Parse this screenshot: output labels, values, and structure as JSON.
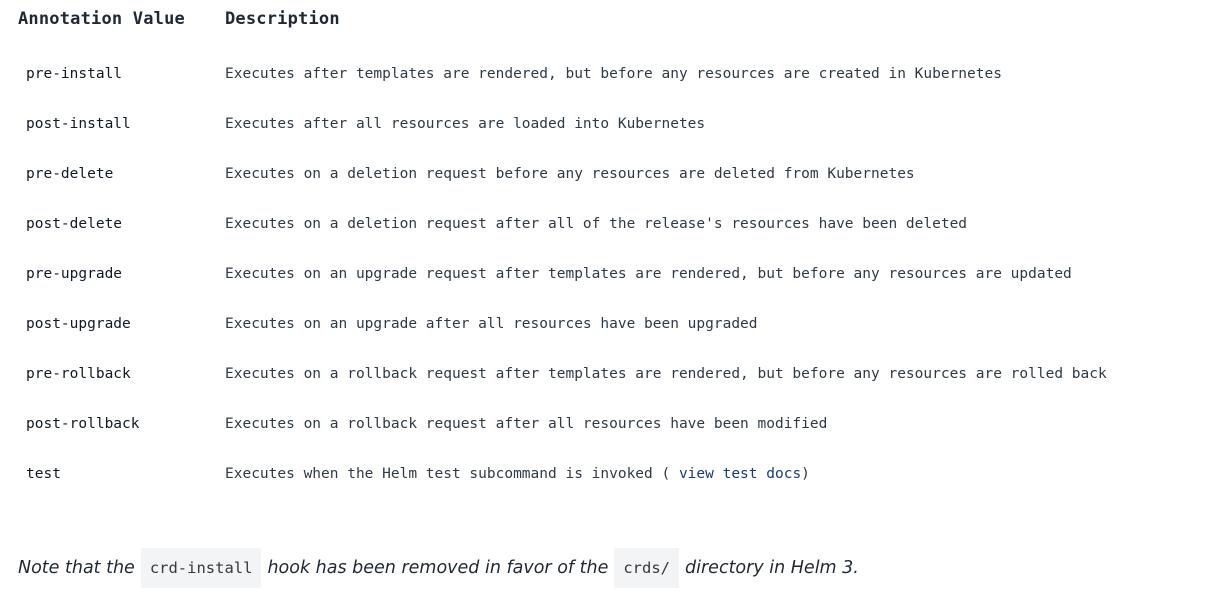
{
  "table": {
    "headers": {
      "annotation": "Annotation Value",
      "description": "Description"
    },
    "rows": [
      {
        "hook": "pre-install",
        "description": "Executes after templates are rendered, but before any resources are created in Kubernetes"
      },
      {
        "hook": "post-install",
        "description": "Executes after all resources are loaded into Kubernetes"
      },
      {
        "hook": "pre-delete",
        "description": "Executes on a deletion request before any resources are deleted from Kubernetes"
      },
      {
        "hook": "post-delete",
        "description": "Executes on a deletion request after all of the release's resources have been deleted"
      },
      {
        "hook": "pre-upgrade",
        "description": "Executes on an upgrade request after templates are rendered, but before any resources are updated"
      },
      {
        "hook": "post-upgrade",
        "description": "Executes on an upgrade after all resources have been upgraded"
      },
      {
        "hook": "pre-rollback",
        "description": "Executes on a rollback request after templates are rendered, but before any resources are rolled back"
      },
      {
        "hook": "post-rollback",
        "description": "Executes on a rollback request after all resources have been modified"
      },
      {
        "hook": "test",
        "description": "Executes when the Helm test subcommand is invoked ( ",
        "link": "view test docs",
        "suffix": ")"
      }
    ]
  },
  "note": {
    "part1": "Note that the",
    "code1": "crd-install",
    "part2": "hook has been removed in favor of the",
    "code2": "crds/",
    "part3": "directory in Helm 3."
  },
  "colors": {
    "link": "#1a3a7a",
    "code_background": "#f3f4f5"
  }
}
